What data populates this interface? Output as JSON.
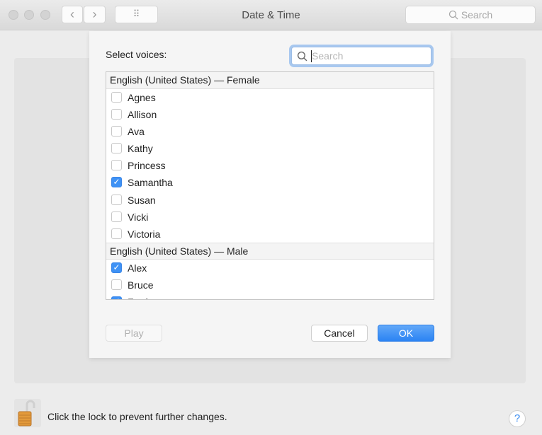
{
  "window": {
    "title": "Date & Time",
    "search_placeholder": "Search",
    "back_glyph": "‹",
    "forward_glyph": "›",
    "grid_glyph": "⠿"
  },
  "sheet": {
    "label": "Select voices:",
    "search_placeholder": "Search",
    "groups": [
      {
        "title": "English (United States) — Female",
        "voices": [
          {
            "name": "Agnes",
            "checked": false
          },
          {
            "name": "Allison",
            "checked": false
          },
          {
            "name": "Ava",
            "checked": false
          },
          {
            "name": "Kathy",
            "checked": false
          },
          {
            "name": "Princess",
            "checked": false
          },
          {
            "name": "Samantha",
            "checked": true
          },
          {
            "name": "Susan",
            "checked": false
          },
          {
            "name": "Vicki",
            "checked": false
          },
          {
            "name": "Victoria",
            "checked": false
          }
        ]
      },
      {
        "title": "English (United States) — Male",
        "voices": [
          {
            "name": "Alex",
            "checked": true
          },
          {
            "name": "Bruce",
            "checked": false
          },
          {
            "name": "Fred",
            "checked": true
          }
        ]
      }
    ],
    "play_label": "Play",
    "cancel_label": "Cancel",
    "ok_label": "OK"
  },
  "footer": {
    "lock_message": "Click the lock to prevent further changes.",
    "help_label": "?"
  },
  "colors": {
    "accent": "#2b83f3",
    "lock": "#e39a3b"
  }
}
